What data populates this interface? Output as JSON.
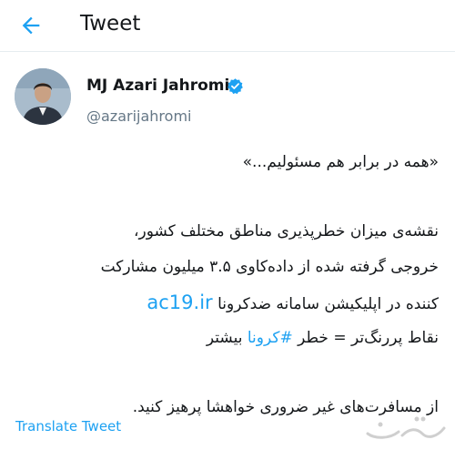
{
  "header": {
    "title": "Tweet",
    "back_icon": "arrow-left-icon"
  },
  "tweet": {
    "display_name": "MJ Azari Jahromi",
    "verified_icon": "verified-badge-icon",
    "handle": "@azarijahromi",
    "lines": {
      "l1": "«همه در برابر هم مسئولیم...»",
      "l2": "نقشه‌ی میزان خطرپذیری مناطق مختلف کشور،",
      "l3": "خروجی گرفته شده از داده‌کاوی ۳.۵ میلیون مشارکت",
      "l4_text": "کننده در اپلیکیشن سامانه ضدکرونا ",
      "l4_link": "ac19.ir",
      "l5_text_a": "نقاط پررنگ‌تر = خطر ",
      "l5_hashtag": "#کرونا",
      "l5_text_b": " بیشتر",
      "l6": "از مسافرت‌های غیر ضروری خواهشا پرهیز کنید."
    },
    "translate_label": "Translate Tweet"
  },
  "colors": {
    "link": "#1da1f2",
    "secondary": "#657786",
    "divider": "#e6ecf0"
  }
}
